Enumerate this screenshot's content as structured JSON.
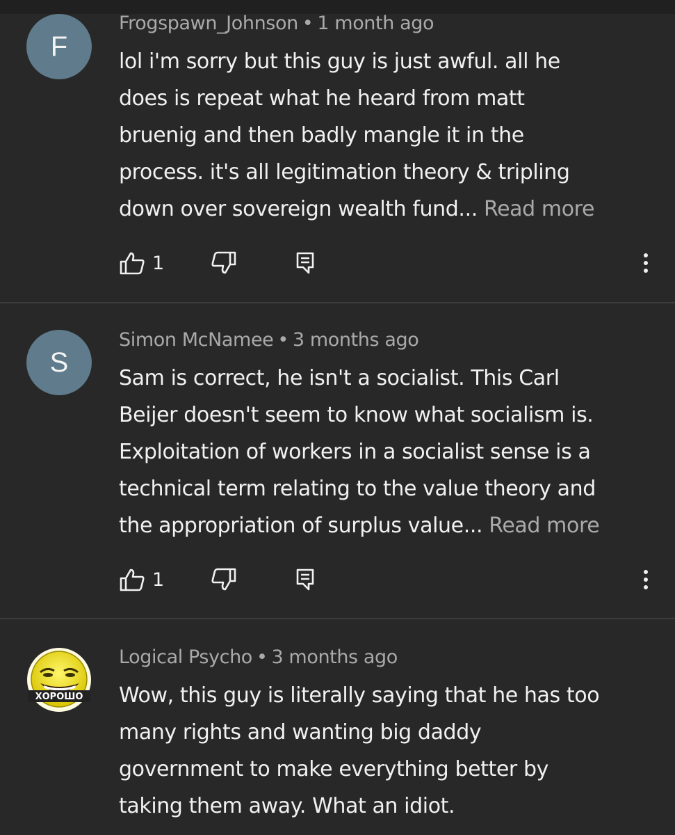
{
  "comments": [
    {
      "avatar_letter": "F",
      "author": "Frogspawn_Johnson",
      "separator": "•",
      "time": "1 month ago",
      "lines": [
        "lol i'm sorry but this guy is just awful. all he",
        "does is repeat what he heard from matt",
        "bruenig and then badly mangle it in the",
        "process. it's all legitimation theory & tripling",
        "down over sovereign wealth fund..."
      ],
      "read_more": "Read more",
      "likes": "1"
    },
    {
      "avatar_letter": "S",
      "author": "Simon McNamee",
      "separator": "•",
      "time": "3 months ago",
      "lines": [
        "Sam is correct, he isn't a socialist. This Carl",
        "Beijer doesn't seem to know what socialism is.",
        "Exploitation of workers in a socialist sense is a",
        "technical term relating to the value theory and",
        "the appropriation of surplus value..."
      ],
      "read_more": "Read more",
      "likes": "1"
    },
    {
      "avatar_text": "ХОРОШО",
      "author": "Logical Psycho",
      "separator": "•",
      "time": "3 months ago",
      "lines": [
        "Wow, this guy is literally saying that he has too",
        "many rights and wanting big daddy",
        "government to make everything better by",
        "taking them away. What an idiot."
      ]
    }
  ],
  "icons": {
    "like": "thumbs-up-icon",
    "dislike": "thumbs-down-icon",
    "reply": "reply-icon",
    "more": "more-vertical-icon"
  },
  "colors": {
    "background": "#282828",
    "text": "#f1f1f1",
    "secondary_text": "#aaaaaa",
    "avatar": "#5f7b8c",
    "divider": "#3d3d3d"
  }
}
